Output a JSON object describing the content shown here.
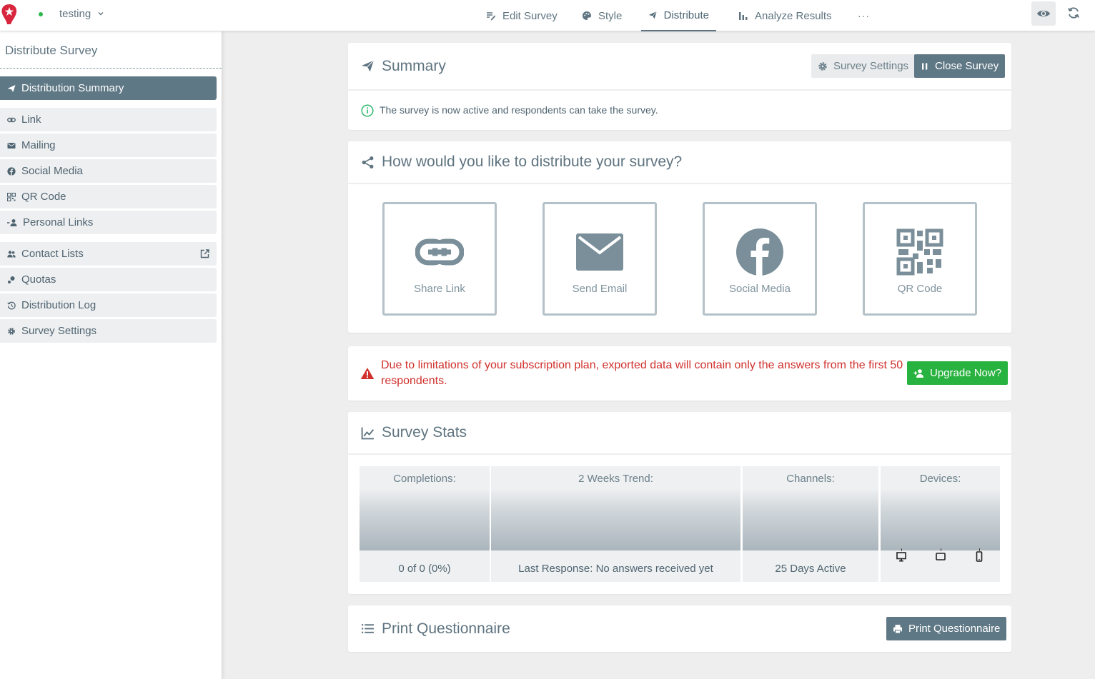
{
  "topbar": {
    "survey_name": "testing",
    "nav": [
      {
        "label": "Edit Survey",
        "icon": "edit-icon"
      },
      {
        "label": "Style",
        "icon": "palette-icon"
      },
      {
        "label": "Distribute",
        "icon": "send-icon",
        "active": true
      },
      {
        "label": "Analyze Results",
        "icon": "bar-chart-icon"
      }
    ],
    "more_label": "···"
  },
  "sidebar": {
    "title": "Distribute Survey",
    "items": [
      {
        "label": "Distribution Summary",
        "icon": "send-icon",
        "active": true
      },
      {
        "label": "Link",
        "icon": "link-icon"
      },
      {
        "label": "Mailing",
        "icon": "envelope-icon"
      },
      {
        "label": "Social Media",
        "icon": "facebook-icon"
      },
      {
        "label": "QR Code",
        "icon": "qr-code-icon"
      },
      {
        "label": "Personal Links",
        "icon": "person-link-icon"
      },
      {
        "label": "Contact Lists",
        "icon": "contacts-icon"
      },
      {
        "label": "Quotas",
        "icon": "quotas-icon"
      },
      {
        "label": "Distribution Log",
        "icon": "history-icon"
      },
      {
        "label": "Survey Settings",
        "icon": "gear-icon"
      }
    ]
  },
  "summary": {
    "title": "Summary",
    "settings_button": "Survey Settings",
    "close_button": "Close Survey",
    "message": "The survey is now active and respondents can take the survey."
  },
  "distribute": {
    "title": "How would you like to distribute your survey?",
    "options": [
      {
        "label": "Share Link",
        "icon": "link-icon"
      },
      {
        "label": "Send Email",
        "icon": "envelope-icon"
      },
      {
        "label": "Social Media",
        "icon": "facebook-icon"
      },
      {
        "label": "QR Code",
        "icon": "qr-code-icon"
      }
    ]
  },
  "warning": {
    "line1": "Due to limitations of your subscription plan, exported data will contain only the answers from the first 50",
    "line2": "respondents.",
    "upgrade_button": "Upgrade Now?"
  },
  "stats": {
    "title": "Survey Stats",
    "columns": [
      {
        "header": "Completions:",
        "footer": "0 of 0 (0%)"
      },
      {
        "header": "2 Weeks Trend:",
        "footer": "Last Response: No answers received yet"
      },
      {
        "header": "Channels:",
        "footer": "25 Days Active"
      },
      {
        "header": "Devices:",
        "footer": ""
      }
    ],
    "devices": [
      "desktop-icon",
      "tablet-icon",
      "mobile-icon"
    ]
  },
  "print": {
    "title": "Print Questionnaire",
    "button": "Print Questionnaire"
  },
  "colors": {
    "accent": "#5f7885",
    "success": "#28b23f",
    "danger": "#d0312d",
    "info": "#2db86b"
  }
}
